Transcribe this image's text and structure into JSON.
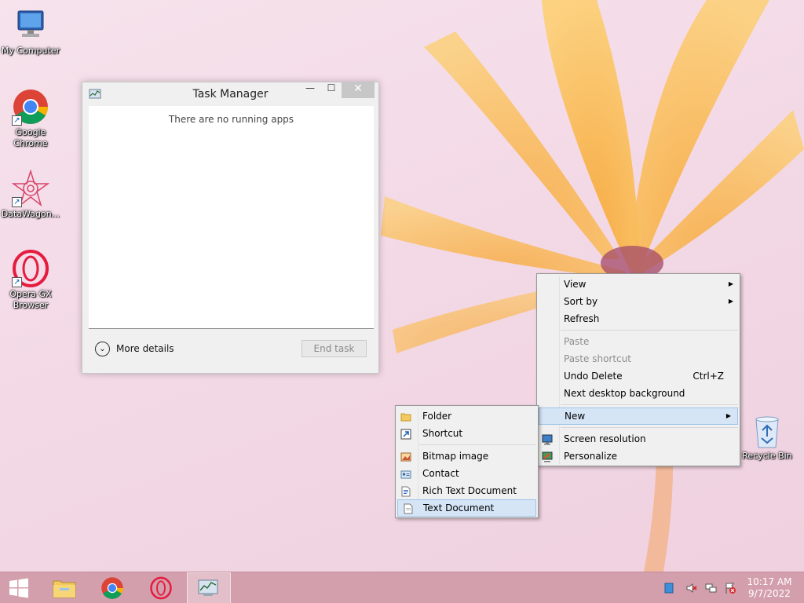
{
  "desktop": {
    "icons": [
      {
        "label": "My Computer"
      },
      {
        "label": "Google Chrome"
      },
      {
        "label": "DataWagon..."
      },
      {
        "label": "Opera GX Browser"
      }
    ],
    "recycle_bin": {
      "label": "Recycle Bin"
    }
  },
  "task_manager": {
    "title": "Task Manager",
    "minimize_glyph": "—",
    "maximize_glyph": "☐",
    "close_glyph": "✕",
    "empty_message": "There are no running apps",
    "more_details_label": "More details",
    "end_task_label": "End task"
  },
  "context_menu": {
    "view": "View",
    "sort_by": "Sort by",
    "refresh": "Refresh",
    "paste": "Paste",
    "paste_shortcut": "Paste shortcut",
    "undo_delete": "Undo Delete",
    "undo_delete_shortcut": "Ctrl+Z",
    "next_background": "Next desktop background",
    "new": "New",
    "screen_resolution": "Screen resolution",
    "personalize": "Personalize",
    "arrow_glyph": "▶"
  },
  "new_submenu": {
    "folder": "Folder",
    "shortcut": "Shortcut",
    "bitmap_image": "Bitmap image",
    "contact": "Contact",
    "rich_text_document": "Rich Text Document",
    "text_document": "Text Document"
  },
  "taskbar": {
    "clock_time": "10:17 AM",
    "clock_date": "9/7/2022"
  },
  "colors": {
    "taskbar": "#d49fac",
    "menu_hover": "#d5e5f6",
    "menu_hover_border": "#9dc3ea"
  }
}
